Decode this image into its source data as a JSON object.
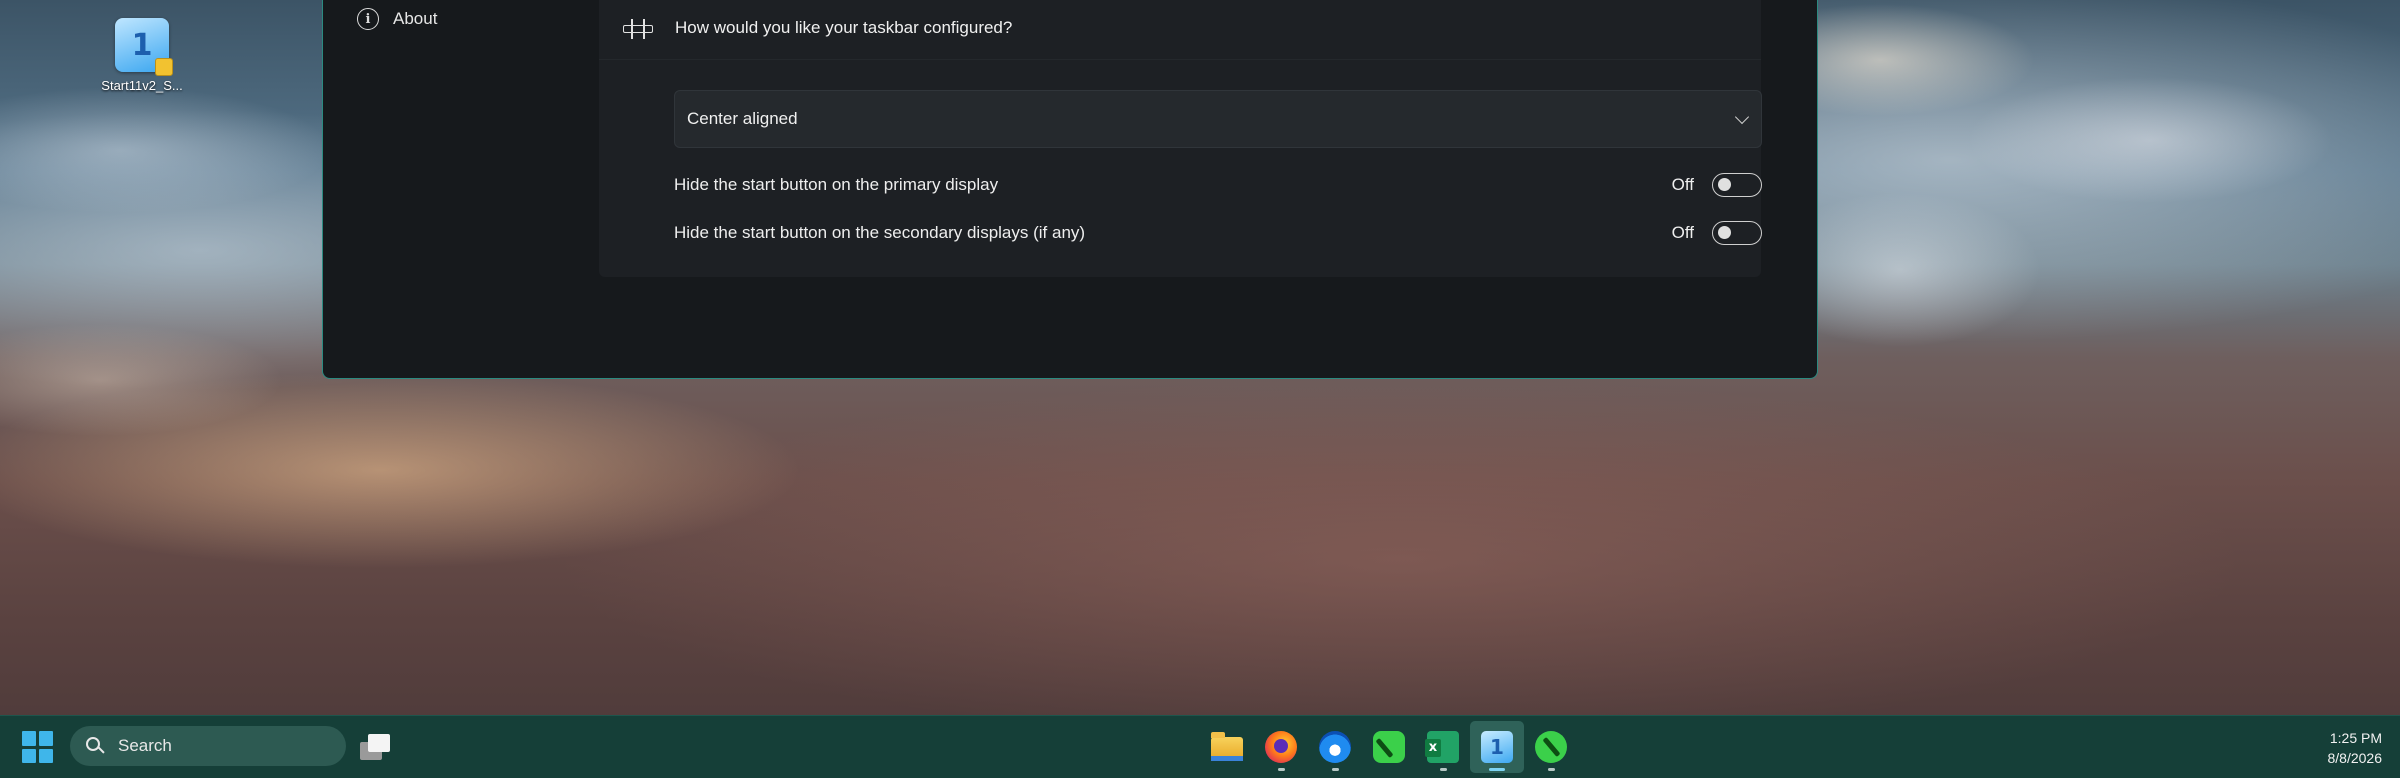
{
  "desktop": {
    "icons": [
      {
        "label": "Start11v2_S...",
        "icon": "start11-app-icon"
      }
    ]
  },
  "window": {
    "nav": {
      "about_label": "About",
      "about_icon": "info-icon"
    },
    "card": {
      "icon": "taskbar-config-icon",
      "title": "How would you like your taskbar configured?",
      "dropdown_value": "Center aligned",
      "toggles": [
        {
          "label": "Hide the start button on the primary display",
          "state": "Off",
          "on": false
        },
        {
          "label": "Hide the start button on the secondary displays (if any)",
          "state": "Off",
          "on": false
        }
      ]
    }
  },
  "taskbar": {
    "search_placeholder": "Search",
    "pinned_apps": [
      {
        "name": "file-explorer",
        "running": false
      },
      {
        "name": "firefox",
        "running": true
      },
      {
        "name": "thunderbird",
        "running": true
      },
      {
        "name": "green-app",
        "running": false
      },
      {
        "name": "excel",
        "running": true
      },
      {
        "name": "start11",
        "running": true,
        "active": true
      },
      {
        "name": "green-app-2",
        "running": true
      }
    ],
    "clock": {
      "time": "1:25 PM",
      "date": "8/8/2026"
    }
  },
  "colors": {
    "window_border": "#2b8a80",
    "taskbar_bg": "#153f38",
    "start_blue": "#3fb6ea"
  }
}
